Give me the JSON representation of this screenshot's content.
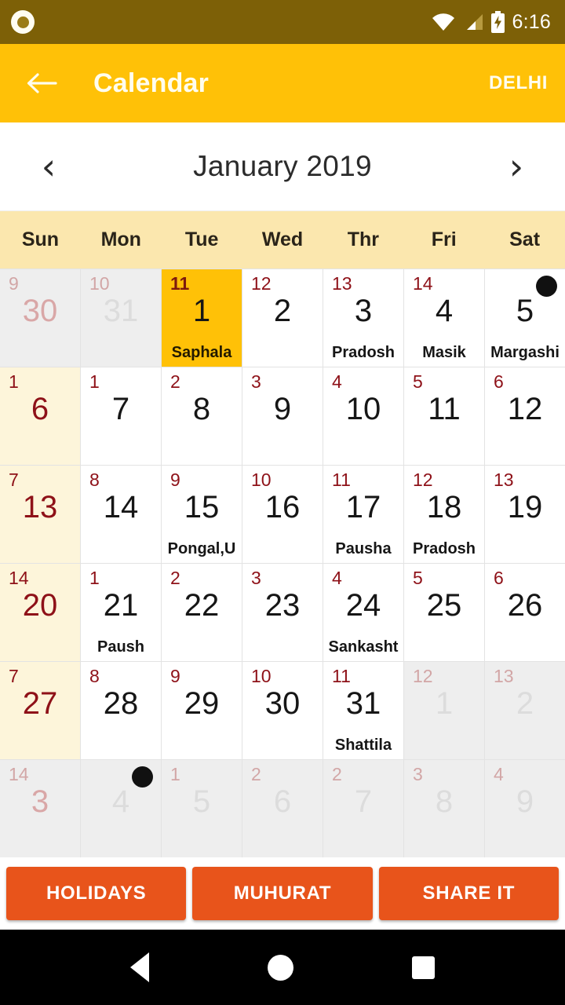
{
  "statusbar": {
    "notification_icon": "circle-notification-icon",
    "wifi_icon": "wifi-icon",
    "signal_icon": "cellular-signal-icon",
    "battery_icon": "battery-charging-icon",
    "time": "6:16"
  },
  "appbar": {
    "back_icon": "back-arrow-icon",
    "title": "Calendar",
    "action_label": "DELHI",
    "background": "#FFC107"
  },
  "monthbar": {
    "prev_icon": "chevron-left-icon",
    "prev_glyph": "‹",
    "next_icon": "chevron-right-icon",
    "next_glyph": "›",
    "title": "January 2019"
  },
  "weekdays": [
    "Sun",
    "Mon",
    "Tue",
    "Wed",
    "Thr",
    "Fri",
    "Sat"
  ],
  "calendar": {
    "month": "January",
    "year": "2019",
    "selected_day": "1",
    "cells": [
      {
        "tithi": "9",
        "day": "30",
        "event": "",
        "out": true,
        "sun": true,
        "sel": false,
        "moon": false
      },
      {
        "tithi": "10",
        "day": "31",
        "event": "",
        "out": true,
        "sun": false,
        "sel": false,
        "moon": false
      },
      {
        "tithi": "11",
        "day": "1",
        "event": "Saphala",
        "out": false,
        "sun": false,
        "sel": true,
        "moon": false
      },
      {
        "tithi": "12",
        "day": "2",
        "event": "",
        "out": false,
        "sun": false,
        "sel": false,
        "moon": false
      },
      {
        "tithi": "13",
        "day": "3",
        "event": "Pradosh",
        "out": false,
        "sun": false,
        "sel": false,
        "moon": false
      },
      {
        "tithi": "14",
        "day": "4",
        "event": "Masik",
        "out": false,
        "sun": false,
        "sel": false,
        "moon": false
      },
      {
        "tithi": "",
        "day": "5",
        "event": "Margashi",
        "out": false,
        "sun": false,
        "sel": false,
        "moon": true
      },
      {
        "tithi": "1",
        "day": "6",
        "event": "",
        "out": false,
        "sun": true,
        "sel": false,
        "moon": false
      },
      {
        "tithi": "1",
        "day": "7",
        "event": "",
        "out": false,
        "sun": false,
        "sel": false,
        "moon": false
      },
      {
        "tithi": "2",
        "day": "8",
        "event": "",
        "out": false,
        "sun": false,
        "sel": false,
        "moon": false
      },
      {
        "tithi": "3",
        "day": "9",
        "event": "",
        "out": false,
        "sun": false,
        "sel": false,
        "moon": false
      },
      {
        "tithi": "4",
        "day": "10",
        "event": "",
        "out": false,
        "sun": false,
        "sel": false,
        "moon": false
      },
      {
        "tithi": "5",
        "day": "11",
        "event": "",
        "out": false,
        "sun": false,
        "sel": false,
        "moon": false
      },
      {
        "tithi": "6",
        "day": "12",
        "event": "",
        "out": false,
        "sun": false,
        "sel": false,
        "moon": false
      },
      {
        "tithi": "7",
        "day": "13",
        "event": "",
        "out": false,
        "sun": true,
        "sel": false,
        "moon": false
      },
      {
        "tithi": "8",
        "day": "14",
        "event": "",
        "out": false,
        "sun": false,
        "sel": false,
        "moon": false
      },
      {
        "tithi": "9",
        "day": "15",
        "event": "Pongal,U",
        "out": false,
        "sun": false,
        "sel": false,
        "moon": false
      },
      {
        "tithi": "10",
        "day": "16",
        "event": "",
        "out": false,
        "sun": false,
        "sel": false,
        "moon": false
      },
      {
        "tithi": "11",
        "day": "17",
        "event": "Pausha",
        "out": false,
        "sun": false,
        "sel": false,
        "moon": false
      },
      {
        "tithi": "12",
        "day": "18",
        "event": "Pradosh",
        "out": false,
        "sun": false,
        "sel": false,
        "moon": false
      },
      {
        "tithi": "13",
        "day": "19",
        "event": "",
        "out": false,
        "sun": false,
        "sel": false,
        "moon": false
      },
      {
        "tithi": "14",
        "day": "20",
        "event": "",
        "out": false,
        "sun": true,
        "sel": false,
        "moon": false
      },
      {
        "tithi": "1",
        "day": "21",
        "event": "Paush",
        "out": false,
        "sun": false,
        "sel": false,
        "moon": false
      },
      {
        "tithi": "2",
        "day": "22",
        "event": "",
        "out": false,
        "sun": false,
        "sel": false,
        "moon": false
      },
      {
        "tithi": "3",
        "day": "23",
        "event": "",
        "out": false,
        "sun": false,
        "sel": false,
        "moon": false
      },
      {
        "tithi": "4",
        "day": "24",
        "event": "Sankasht",
        "out": false,
        "sun": false,
        "sel": false,
        "moon": false
      },
      {
        "tithi": "5",
        "day": "25",
        "event": "",
        "out": false,
        "sun": false,
        "sel": false,
        "moon": false
      },
      {
        "tithi": "6",
        "day": "26",
        "event": "",
        "out": false,
        "sun": false,
        "sel": false,
        "moon": false
      },
      {
        "tithi": "7",
        "day": "27",
        "event": "",
        "out": false,
        "sun": true,
        "sel": false,
        "moon": false
      },
      {
        "tithi": "8",
        "day": "28",
        "event": "",
        "out": false,
        "sun": false,
        "sel": false,
        "moon": false
      },
      {
        "tithi": "9",
        "day": "29",
        "event": "",
        "out": false,
        "sun": false,
        "sel": false,
        "moon": false
      },
      {
        "tithi": "10",
        "day": "30",
        "event": "",
        "out": false,
        "sun": false,
        "sel": false,
        "moon": false
      },
      {
        "tithi": "11",
        "day": "31",
        "event": "Shattila",
        "out": false,
        "sun": false,
        "sel": false,
        "moon": false
      },
      {
        "tithi": "12",
        "day": "1",
        "event": "",
        "out": true,
        "sun": false,
        "sel": false,
        "moon": false
      },
      {
        "tithi": "13",
        "day": "2",
        "event": "",
        "out": true,
        "sun": false,
        "sel": false,
        "moon": false
      },
      {
        "tithi": "14",
        "day": "3",
        "event": "",
        "out": true,
        "sun": true,
        "sel": false,
        "moon": false
      },
      {
        "tithi": "",
        "day": "4",
        "event": "",
        "out": true,
        "sun": false,
        "sel": false,
        "moon": true
      },
      {
        "tithi": "1",
        "day": "5",
        "event": "",
        "out": true,
        "sun": false,
        "sel": false,
        "moon": false
      },
      {
        "tithi": "2",
        "day": "6",
        "event": "",
        "out": true,
        "sun": false,
        "sel": false,
        "moon": false
      },
      {
        "tithi": "2",
        "day": "7",
        "event": "",
        "out": true,
        "sun": false,
        "sel": false,
        "moon": false
      },
      {
        "tithi": "3",
        "day": "8",
        "event": "",
        "out": true,
        "sun": false,
        "sel": false,
        "moon": false
      },
      {
        "tithi": "4",
        "day": "9",
        "event": "",
        "out": true,
        "sun": false,
        "sel": false,
        "moon": false
      }
    ]
  },
  "actions": {
    "buttons": [
      "HOLIDAYS",
      "MUHURAT",
      "SHARE IT"
    ],
    "color": "#E8541B"
  },
  "navbar": {
    "back_icon": "android-back-icon",
    "home_icon": "android-home-icon",
    "recents_icon": "android-recents-icon"
  }
}
